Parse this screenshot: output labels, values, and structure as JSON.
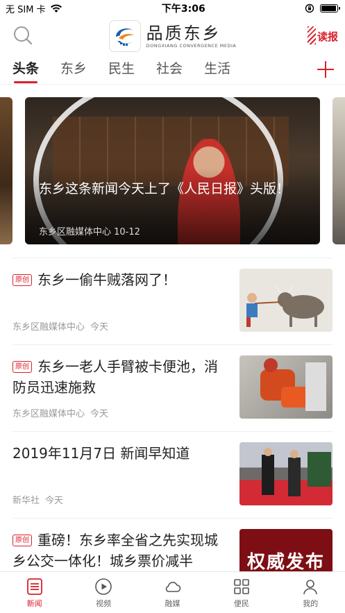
{
  "status_bar": {
    "carrier": "无 SIM 卡",
    "time": "下午3:06",
    "battery_level": 0.95
  },
  "header": {
    "brand_name": "品质东乡",
    "brand_subtitle": "DONGXIANG CONVERGENCE MEDIA",
    "read_label": "读报",
    "search_icon": "search-icon",
    "logo_icon": "brand-logo-icon"
  },
  "tabs": [
    {
      "label": "头条",
      "active": true
    },
    {
      "label": "东乡",
      "active": false
    },
    {
      "label": "民生",
      "active": false
    },
    {
      "label": "社会",
      "active": false
    },
    {
      "label": "生活",
      "active": false
    }
  ],
  "hero": {
    "title": "东乡这条新闻今天上了《人民日报》头版！",
    "source": "东乡区融媒体中心",
    "date": "10-12"
  },
  "news": [
    {
      "badge": "原创",
      "title": "东乡一偷牛贼落网了！",
      "source": "东乡区融媒体中心",
      "time": "今天"
    },
    {
      "badge": "原创",
      "title": "东乡一老人手臂被卡便池，消防员迅速施救",
      "source": "东乡区融媒体中心",
      "time": "今天"
    },
    {
      "badge": "",
      "title": "2019年11月7日 新闻早知道",
      "source": "新华社",
      "time": "今天"
    },
    {
      "badge": "原创",
      "title": "重磅！东乡率全省之先实现城乡公交一体化！城乡票价减半",
      "source": "",
      "time": "",
      "thumb_text": "权威发布"
    }
  ],
  "bottom_nav": [
    {
      "label": "新闻",
      "icon": "news-list-icon",
      "active": true
    },
    {
      "label": "视频",
      "icon": "play-icon",
      "active": false
    },
    {
      "label": "融媒",
      "icon": "cloud-icon",
      "active": false
    },
    {
      "label": "便民",
      "icon": "grid-apps-icon",
      "active": false
    },
    {
      "label": "我的",
      "icon": "user-icon",
      "active": false
    }
  ],
  "colors": {
    "accent": "#d8202a",
    "text_primary": "#222222",
    "text_meta": "#999999"
  }
}
